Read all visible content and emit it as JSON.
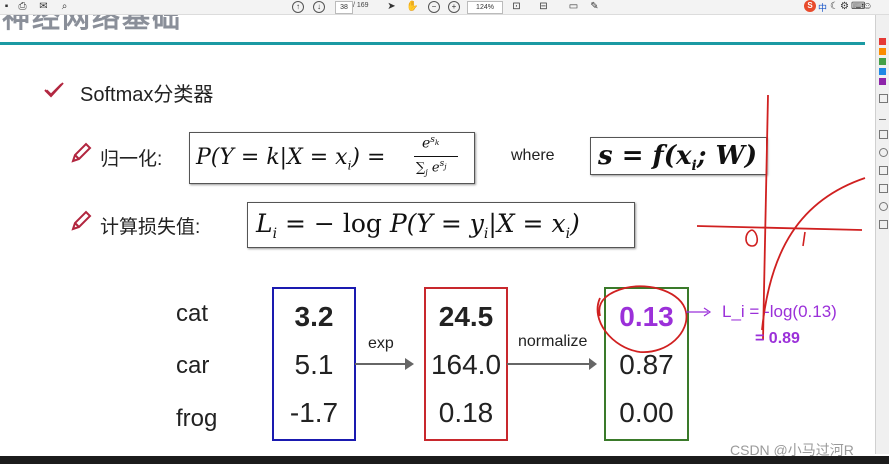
{
  "toolbar": {
    "page_current": "38",
    "page_total": "/ 169",
    "zoom": "124%",
    "brand_text": "中"
  },
  "slide": {
    "title": "神经网络基础",
    "bullet": "Softmax分类器",
    "norm_label": "归一化:",
    "loss_label": "计算损失值:",
    "where": "where",
    "classes": [
      "cat",
      "car",
      "frog"
    ],
    "scores": [
      "3.2",
      "5.1",
      "-1.7"
    ],
    "exp_values": [
      "24.5",
      "164.0",
      "0.18"
    ],
    "probs": [
      "0.13",
      "0.87",
      "0.00"
    ],
    "exp_label": "exp",
    "normalize_label": "normalize"
  },
  "annotation": {
    "loss_line1": "L_i = -log(0.13)",
    "loss_line2": "= 0.89"
  },
  "watermark": "CSDN @小马过河R",
  "colors": {
    "score_box": "#1a1ab0",
    "exp_box": "#c8282d",
    "prob_box": "#3a7a2a",
    "annotation": "#9b30d9",
    "title_rule": "#1b9aa3"
  }
}
